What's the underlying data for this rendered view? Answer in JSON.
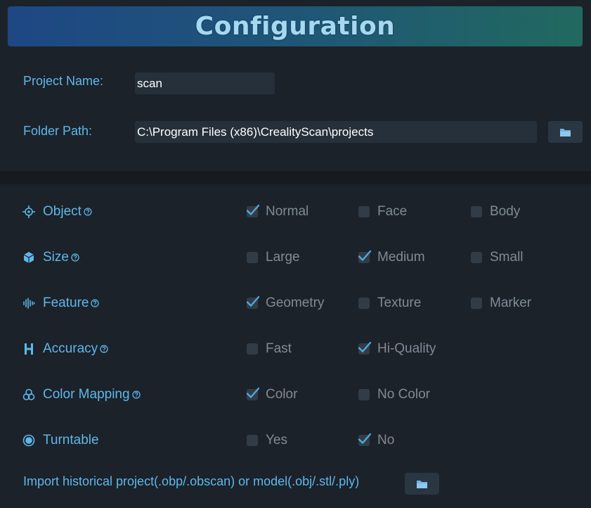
{
  "header": {
    "title": "Configuration"
  },
  "project": {
    "label": "Project Name:",
    "value": "scan"
  },
  "folder": {
    "label": "Folder Path:",
    "value": "C:\\Program Files (x86)\\CrealityScan\\projects",
    "button_icon": "folder-icon"
  },
  "options": [
    {
      "key": "object",
      "icon": "crosshair-icon",
      "label": "Object",
      "help": true,
      "choices": [
        {
          "label": "Normal",
          "checked": true
        },
        {
          "label": "Face",
          "checked": false
        },
        {
          "label": "Body",
          "checked": false
        }
      ]
    },
    {
      "key": "size",
      "icon": "cube-icon",
      "label": "Size",
      "help": true,
      "choices": [
        {
          "label": "Large",
          "checked": false
        },
        {
          "label": "Medium",
          "checked": true
        },
        {
          "label": "Small",
          "checked": false
        }
      ]
    },
    {
      "key": "feature",
      "icon": "waveform-icon",
      "label": "Feature",
      "help": true,
      "choices": [
        {
          "label": "Geometry",
          "checked": true
        },
        {
          "label": "Texture",
          "checked": false
        },
        {
          "label": "Marker",
          "checked": false
        }
      ]
    },
    {
      "key": "accuracy",
      "icon": "h-letter-icon",
      "label": "Accuracy",
      "help": true,
      "choices": [
        {
          "label": "Fast",
          "checked": false
        },
        {
          "label": "Hi-Quality",
          "checked": true
        }
      ]
    },
    {
      "key": "color-mapping",
      "icon": "color-circles-icon",
      "label": "Color Mapping",
      "help": true,
      "choices": [
        {
          "label": "Color",
          "checked": true
        },
        {
          "label": "No Color",
          "checked": false
        }
      ]
    },
    {
      "key": "turntable",
      "icon": "turntable-icon",
      "label": "Turntable",
      "help": false,
      "choices": [
        {
          "label": "Yes",
          "checked": false
        },
        {
          "label": "No",
          "checked": true
        }
      ]
    }
  ],
  "import": {
    "label": "Import historical project(.obp/.obscan) or model(.obj/.stl/.ply)",
    "button_icon": "folder-icon"
  },
  "colors": {
    "accent": "#5fb7ea",
    "checkmark": "#4fa8de",
    "background": "#1b2229"
  }
}
